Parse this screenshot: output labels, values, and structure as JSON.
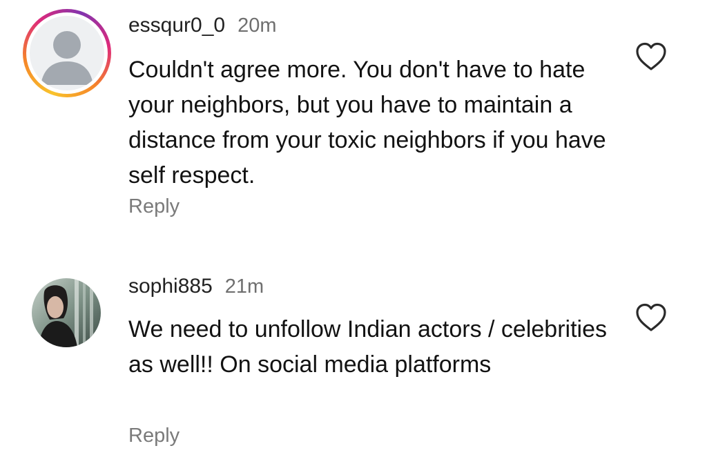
{
  "comments": [
    {
      "username": "essqur0_0",
      "time": "20m",
      "text": "Couldn't agree more. You don't have to hate your neighbors, but you have to maintain a distance from your toxic neighbors if you have self respect.",
      "reply_label": "Reply",
      "avatar_icon": "default-user-avatar-icon",
      "like_icon": "heart-outline-icon"
    },
    {
      "username": "sophi885",
      "time": "21m",
      "text": "We need to unfollow Indian actors / celebrities as well!! On social media platforms",
      "reply_label": "Reply",
      "avatar_icon": "profile-photo",
      "like_icon": "heart-outline-icon"
    }
  ],
  "colors": {
    "story_ring": [
      "#f9c32c",
      "#f58529",
      "#dd2a7b",
      "#8134af"
    ],
    "text": "#121212",
    "secondary_text": "#6f6f6f",
    "icon": "#2a2a2a"
  }
}
